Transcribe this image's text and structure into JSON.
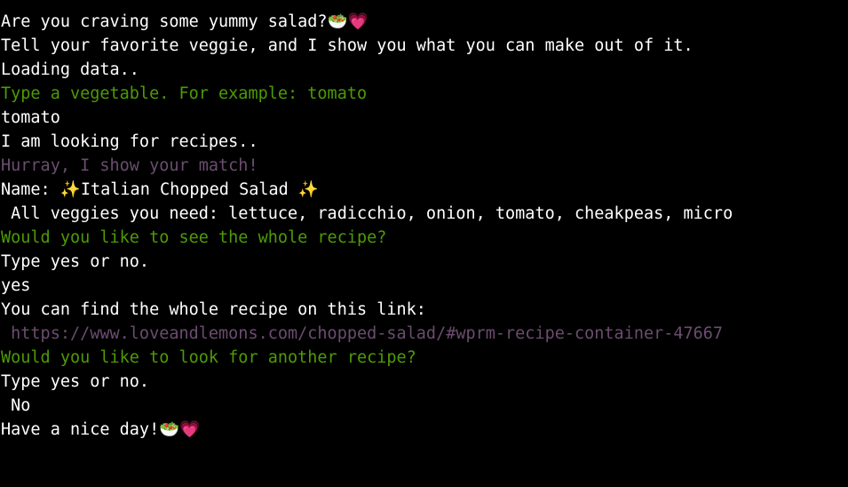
{
  "terminal": {
    "lines": [
      {
        "text": "Are you craving some yummy salad?🥗💗",
        "color": "#ffffff"
      },
      {
        "text": "Tell your favorite veggie, and I show you what you can make out of it.",
        "color": "#ffffff"
      },
      {
        "text": "Loading data..",
        "color": "#ffffff"
      },
      {
        "text": "Type a vegetable. For example: tomato",
        "color": "#4e9a06"
      },
      {
        "text": "tomato",
        "color": "#ffffff"
      },
      {
        "text": "I am looking for recipes..",
        "color": "#ffffff"
      },
      {
        "text": "Hurray, I show your match!",
        "color": "#6b4d6f"
      },
      {
        "text": "Name: ✨Italian Chopped Salad ✨",
        "color": "#ffffff"
      },
      {
        "text": " All veggies you need: lettuce, radicchio, onion, tomato, cheakpeas, micro",
        "color": "#ffffff"
      },
      {
        "text": "Would you like to see the whole recipe?",
        "color": "#4e9a06"
      },
      {
        "text": "Type yes or no.",
        "color": "#ffffff"
      },
      {
        "text": "yes",
        "color": "#ffffff"
      },
      {
        "text": "You can find the whole recipe on this link:",
        "color": "#ffffff"
      },
      {
        "text": " https://www.loveandlemons.com/chopped-salad/#wprm-recipe-container-47667",
        "color": "#6b4d6f"
      },
      {
        "text": "Would you like to look for another recipe?",
        "color": "#4e9a06"
      },
      {
        "text": "Type yes or no.",
        "color": "#ffffff"
      },
      {
        "text": " No",
        "color": "#ffffff"
      },
      {
        "text": "Have a nice day!🥗💗",
        "color": "#ffffff"
      }
    ]
  }
}
